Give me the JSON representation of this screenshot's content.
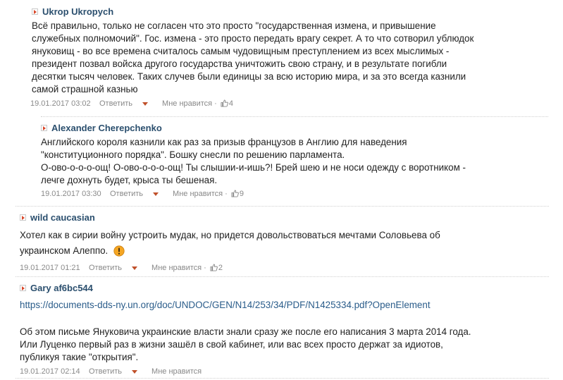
{
  "comments": [
    {
      "author": "Ukrop Ukropych",
      "lines": [
        "Всё правильно, только не согласен что это просто \"государственная измена, и привышение",
        "служебных полномочий\". Гос. измена - это просто передать врагу секрет. А то что сотворил ублюдок",
        "януковищ - во все времена считалось самым чудовищным преступлением из всех мыслимых -",
        "президент позвал войска другого государства уничтожить свою страну, и в результате погибли",
        "десятки тысяч человек. Таких случев были единицы за всю историю мира, и за это всегда казнили",
        "самой страшной казнью"
      ],
      "date": "19.01.2017 03:02",
      "reply": "Ответить",
      "likes": "Мне нравится",
      "count": "4"
    },
    {
      "author": "Alexander Cherepchenko",
      "lines": [
        "Английского короля казнили как раз за призыв французов в Англию для наведения",
        "\"конституционного порядка\". Бошку снесли по решению парламента.",
        "О-ово-о-о-о-ощ! О-ово-о-о-о-ощ! Ты слышии-и-ишь?! Брей шею и не носи одежду с воротником -",
        "лечге дохнуть будет, крыса ты бешеная."
      ],
      "date": "19.01.2017 03:30",
      "reply": "Ответить",
      "likes": "Мне нравится",
      "count": "9"
    },
    {
      "author": "wild caucasian",
      "lines": [
        "Хотел как в сирии войну устроить мудак, но придется довольствоваться мечтами Соловьева об",
        "украинском Алеппо."
      ],
      "date": "19.01.2017 01:21",
      "reply": "Ответить",
      "likes": "Мне нравится",
      "count": "2"
    },
    {
      "author": "Gary af6bc544",
      "link": "https://documents-dds-ny.un.org/doc/UNDOC/GEN/N14/253/34/PDF/N1425334.pdf?OpenElement",
      "lines": [
        "Об этом письме Януковича украинские власти знали сразу же после его написания 3 марта 2014 года.",
        "Или Луценко первый раз в жизни зашёл в свой кабинет, или вас всех просто держат за идиотов,",
        "публикуя такие \"открытия\"."
      ],
      "date": "19.01.2017 02:14",
      "reply": "Ответить",
      "likes": "Мне нравится"
    }
  ],
  "colors": {
    "author": "#2b4f6e",
    "link": "#2a5c8a",
    "caret": "#c0502a",
    "warning": "#f5a623"
  },
  "icons": {
    "header_arrow": "collapse-arrow-icon",
    "likes": "thumbs-up-icon",
    "emoji": "warning-emoji-icon"
  }
}
